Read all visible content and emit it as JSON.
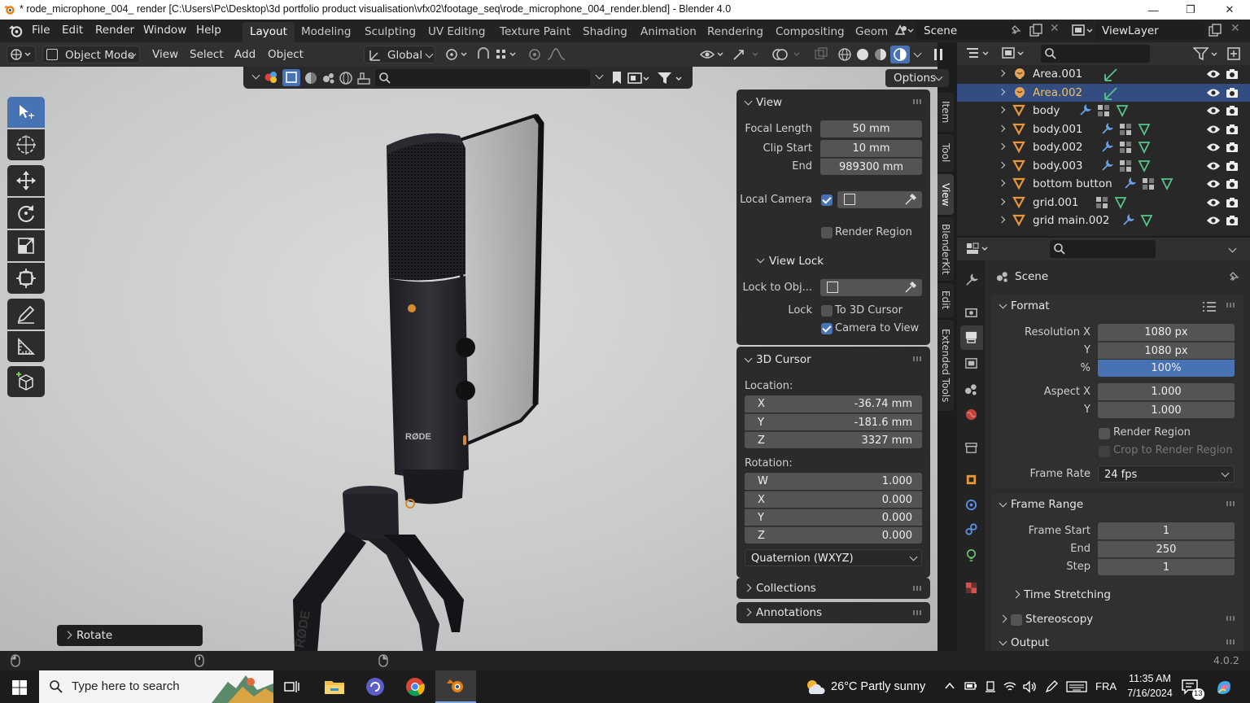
{
  "window": {
    "title": "* rode_microphone_004_ render [C:\\Users\\Pc\\Desktop\\3d portfolio product visualisation\\vfx02\\footage_seq\\rode_microphone_004_render.blend] - Blender 4.0"
  },
  "menu": [
    "File",
    "Edit",
    "Render",
    "Window",
    "Help"
  ],
  "workspaces": [
    "Layout",
    "Modeling",
    "Sculpting",
    "UV Editing",
    "Texture Paint",
    "Shading",
    "Animation",
    "Rendering",
    "Compositing",
    "Geom"
  ],
  "scene_name": "Scene",
  "viewlayer_name": "ViewLayer",
  "header": {
    "mode": "Object Mode",
    "view": "View",
    "select": "Select",
    "add": "Add",
    "object": "Object",
    "orientation": "Global",
    "options": "Options"
  },
  "operator": "Rotate",
  "npanel": {
    "tabs": [
      "Item",
      "Tool",
      "View",
      "BlenderKit",
      "Edit",
      "Extended Tools"
    ],
    "view": {
      "title": "View",
      "focal_label": "Focal Length",
      "focal": "50 mm",
      "clip_start_label": "Clip Start",
      "clip_start": "10 mm",
      "end_label": "End",
      "end": "989300 mm",
      "local_camera": "Local Camera",
      "render_region": "Render Region"
    },
    "view_lock": {
      "title": "View Lock",
      "lock_obj": "Lock to Obj...",
      "lock": "Lock",
      "to_cursor": "To 3D Cursor",
      "camera_to_view": "Camera to View"
    },
    "cursor": {
      "title": "3D Cursor",
      "location": "Location:",
      "x_l": "X",
      "x": "-36.74 mm",
      "y_l": "Y",
      "y": "-181.6 mm",
      "z_l": "Z",
      "z": "3327 mm",
      "rotation": "Rotation:",
      "w_l": "W",
      "w": "1.000",
      "rx_l": "X",
      "rx": "0.000",
      "ry_l": "Y",
      "ry": "0.000",
      "rz_l": "Z",
      "rz": "0.000",
      "mode": "Quaternion (WXYZ)"
    },
    "collections": "Collections",
    "annotations": "Annotations"
  },
  "outliner": [
    {
      "name": "Area.001",
      "type": "light"
    },
    {
      "name": "Area.002",
      "type": "light",
      "selected": true
    },
    {
      "name": "body",
      "type": "mesh"
    },
    {
      "name": "body.001",
      "type": "mesh"
    },
    {
      "name": "body.002",
      "type": "mesh"
    },
    {
      "name": "body.003",
      "type": "mesh"
    },
    {
      "name": "bottom button",
      "type": "mesh"
    },
    {
      "name": "grid.001",
      "type": "mesh"
    },
    {
      "name": "grid main.002",
      "type": "mesh"
    }
  ],
  "properties": {
    "scene": "Scene",
    "format": {
      "title": "Format",
      "res_x_l": "Resolution X",
      "res_x": "1080 px",
      "res_y_l": "Y",
      "res_y": "1080 px",
      "pct_l": "%",
      "pct": "100%",
      "aspect_x_l": "Aspect X",
      "aspect_x": "1.000",
      "aspect_y_l": "Y",
      "aspect_y": "1.000",
      "render_region": "Render Region",
      "crop": "Crop to Render Region",
      "frame_rate_l": "Frame Rate",
      "frame_rate": "24 fps"
    },
    "frame_range": {
      "title": "Frame Range",
      "start_l": "Frame Start",
      "start": "1",
      "end_l": "End",
      "end": "250",
      "step_l": "Step",
      "step": "1"
    },
    "time_stretching": "Time Stretching",
    "stereoscopy": "Stereoscopy",
    "output": "Output"
  },
  "status": {
    "version": "4.0.2"
  },
  "taskbar": {
    "search": "Type here to search",
    "weather": "26°C  Partly sunny",
    "lang": "FRA",
    "time": "11:35 AM",
    "date": "7/16/2024",
    "notif": "13"
  },
  "colors": {
    "accent": "#4772b3",
    "selected_row": "#334d80",
    "light_icon": "#e0a45a",
    "mesh_icon": "#e8963a",
    "active_text": "#f0c060"
  }
}
